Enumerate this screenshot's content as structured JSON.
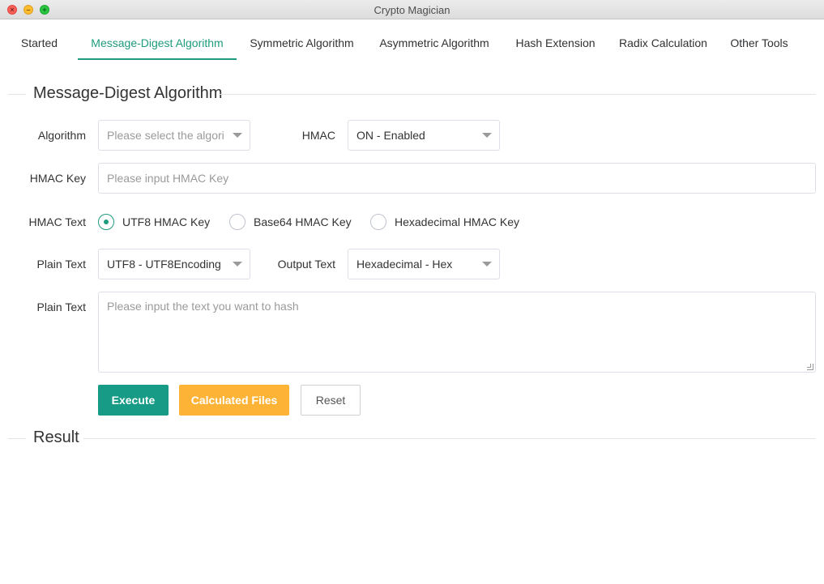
{
  "window": {
    "title": "Crypto Magician"
  },
  "tabs": [
    {
      "label": "Started"
    },
    {
      "label": "Message-Digest Algorithm"
    },
    {
      "label": "Symmetric Algorithm"
    },
    {
      "label": "Asymmetric Algorithm"
    },
    {
      "label": "Hash Extension"
    },
    {
      "label": "Radix Calculation"
    },
    {
      "label": "Other Tools"
    }
  ],
  "active_tab": "Message-Digest Algorithm",
  "section_title": "Message-Digest Algorithm",
  "form": {
    "algorithm_label": "Algorithm",
    "algorithm_placeholder": "Please select the algorit",
    "hmac_label": "HMAC",
    "hmac_value": "ON - Enabled",
    "hmac_key_label": "HMAC Key",
    "hmac_key_placeholder": "Please input HMAC Key",
    "hmac_text_label": "HMAC Text",
    "hmac_text_options": [
      "UTF8 HMAC Key",
      "Base64 HMAC Key",
      "Hexadecimal HMAC Key"
    ],
    "hmac_text_selected": "UTF8 HMAC Key",
    "plain_text_encoding_label": "Plain Text",
    "plain_text_encoding_value": "UTF8 - UTF8Encoding",
    "output_text_label": "Output Text",
    "output_text_value": "Hexadecimal - Hex",
    "plain_text_label": "Plain Text",
    "plain_text_placeholder": "Please input the text you want to hash"
  },
  "buttons": {
    "execute": "Execute",
    "calculated_files": "Calculated Files",
    "reset": "Reset"
  },
  "result_title": "Result",
  "colors": {
    "accent": "#1e9b7d",
    "execute": "#179b86",
    "calculated_files": "#fcb336"
  }
}
